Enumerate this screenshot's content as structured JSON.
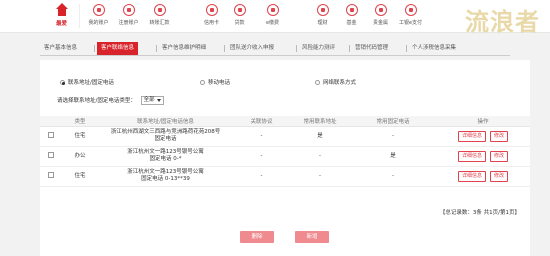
{
  "nav": {
    "items": [
      {
        "label": "最爱",
        "icon": "home-icon"
      },
      {
        "label": "我的账户",
        "icon": "account-icon"
      },
      {
        "label": "注册账户",
        "icon": "register-icon"
      },
      {
        "label": "转账汇款",
        "icon": "transfer-icon"
      },
      {
        "label": "信用卡",
        "icon": "credit-card-icon"
      },
      {
        "label": "贷款",
        "icon": "loan-icon"
      },
      {
        "label": "e缴费",
        "icon": "payment-icon"
      },
      {
        "label": "理财",
        "icon": "finance-icon"
      },
      {
        "label": "基金",
        "icon": "fund-icon"
      },
      {
        "label": "贵金属",
        "icon": "gold-icon"
      },
      {
        "label": "工银e支付",
        "icon": "epay-icon"
      }
    ],
    "watermark": "流浪者"
  },
  "subtabs": [
    "客户基本信息",
    "客户联络信息",
    "客户信息维护明细",
    "团队送介收入申报",
    "风险能力测评",
    "营销代码管理",
    "个人涉税信息采集"
  ],
  "filters": {
    "radios": [
      "联系地址/固定电话",
      "移动电话",
      "网络联系方式"
    ],
    "type_label": "请选择联系地址/固定电话类型：",
    "type_value": "全部"
  },
  "table": {
    "headers": [
      "",
      "类型",
      "联系地址/固定电话信息",
      "关联协议",
      "常用联系地址",
      "常用固定电话",
      "操作"
    ],
    "rows": [
      {
        "type": "住宅",
        "info_line1": "浙江杭州西湖文三西路与竞洲路荷花苑208号",
        "info_line2": "固定电话",
        "agreement": "-",
        "common_addr": "是",
        "common_phone": "-"
      },
      {
        "type": "办公",
        "info_line1": "浙江杭州文一路123号银号公寓",
        "info_line2": "固定电话 0-*",
        "agreement": "-",
        "common_addr": "-",
        "common_phone": "是"
      },
      {
        "type": "住宅",
        "info_line1": "浙江杭州文一路123号银号公寓",
        "info_line2": "固定电话 0-13**39",
        "agreement": "-",
        "common_addr": "-",
        "common_phone": "-"
      }
    ],
    "detail_label": "详细信息",
    "edit_label": "修改"
  },
  "summary": "【总记录数：3条 共1页/第1页】",
  "buttons": {
    "delete": "删除",
    "add": "新增"
  }
}
